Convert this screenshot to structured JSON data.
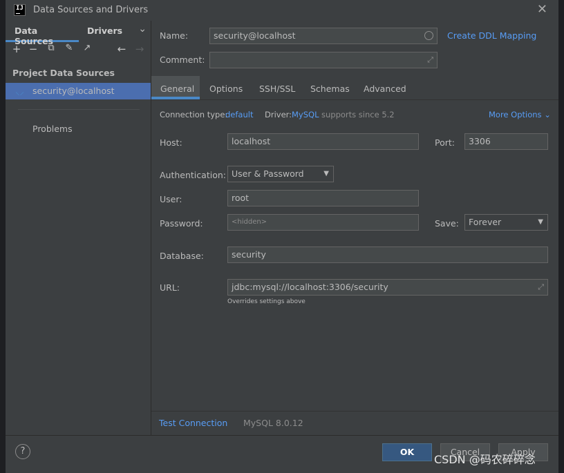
{
  "window": {
    "title": "Data Sources and Drivers",
    "icon_text": "IJ"
  },
  "left_panel": {
    "tabs": [
      "Data Sources",
      "Drivers"
    ],
    "section_title": "Project Data Sources",
    "items": [
      {
        "label": "security@localhost",
        "selected": true
      }
    ],
    "problems_label": "Problems"
  },
  "form": {
    "name_label": "Name:",
    "name_value": "security@localhost",
    "ddl_link": "Create DDL Mapping",
    "comment_label": "Comment:",
    "comment_value": "",
    "tabs": [
      "General",
      "Options",
      "SSH/SSL",
      "Schemas",
      "Advanced"
    ],
    "active_tab": "General",
    "connection_type_label": "Connection type:",
    "connection_type_value": "default",
    "driver_label": "Driver:",
    "driver_value": "MySQL",
    "driver_note": "supports since 5.2",
    "more_options": "More Options",
    "host_label": "Host:",
    "host_value": "localhost",
    "port_label": "Port:",
    "port_value": "3306",
    "auth_label": "Authentication:",
    "auth_value": "User & Password",
    "user_label": "User:",
    "user_value": "root",
    "password_label": "Password:",
    "password_placeholder": "<hidden>",
    "save_label": "Save:",
    "save_value": "Forever",
    "database_label": "Database:",
    "database_value": "security",
    "url_label": "URL:",
    "url_value": "jdbc:mysql://localhost:3306/security",
    "url_hint": "Overrides settings above",
    "test_connection": "Test Connection",
    "server_version": "MySQL 8.0.12"
  },
  "footer": {
    "help": "?",
    "ok": "OK",
    "cancel": "Cancel",
    "apply": "Apply"
  },
  "watermark": "CSDN @码农碎碎念",
  "colors": {
    "accent": "#4a88c7",
    "link": "#589df6",
    "selection": "#4b6eaf",
    "primary_button": "#365880"
  }
}
